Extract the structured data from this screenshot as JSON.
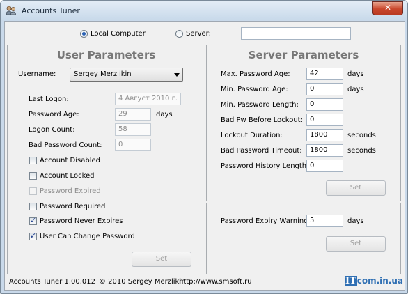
{
  "window": {
    "title": "Accounts Tuner",
    "close_glyph": "✕"
  },
  "target": {
    "local_label": "Local Computer",
    "server_label": "Server:",
    "server_value": "",
    "selected": "local"
  },
  "user_panel": {
    "title": "User Parameters",
    "username_label": "Username:",
    "username_value": "Sergey Merzlikin",
    "fields": [
      {
        "label": "Last Logon:",
        "value": "4 Август 2010 г.",
        "unit": ""
      },
      {
        "label": "Password Age:",
        "value": "29",
        "unit": "days"
      },
      {
        "label": "Logon Count:",
        "value": "58",
        "unit": ""
      },
      {
        "label": "Bad Password Count:",
        "value": "0",
        "unit": ""
      }
    ],
    "checkboxes": [
      {
        "label": "Account Disabled",
        "checked": false,
        "enabled": true
      },
      {
        "label": "Account Locked",
        "checked": false,
        "enabled": true
      },
      {
        "label": "Password Expired",
        "checked": false,
        "enabled": false
      },
      {
        "label": "Password Required",
        "checked": false,
        "enabled": true
      },
      {
        "label": "Password Never Expires",
        "checked": true,
        "enabled": true
      },
      {
        "label": "User Can Change Password",
        "checked": true,
        "enabled": true
      }
    ],
    "set_label": "Set"
  },
  "server_panel": {
    "title": "Server Parameters",
    "fields": [
      {
        "label": "Max. Password Age:",
        "value": "42",
        "unit": "days"
      },
      {
        "label": "Min. Password Age:",
        "value": "0",
        "unit": "days"
      },
      {
        "label": "Min. Password Length:",
        "value": "0",
        "unit": ""
      },
      {
        "label": "Bad Pw Before Lockout:",
        "value": "0",
        "unit": ""
      },
      {
        "label": "Lockout Duration:",
        "value": "1800",
        "unit": "seconds"
      },
      {
        "label": "Bad Password Timeout:",
        "value": "1800",
        "unit": "seconds"
      },
      {
        "label": "Password History Length:",
        "value": "0",
        "unit": ""
      }
    ],
    "set_label": "Set"
  },
  "expiry_panel": {
    "label": "Password Expiry Warning:",
    "value": "5",
    "unit": "days",
    "set_label": "Set"
  },
  "statusbar": {
    "version": "Accounts Tuner 1.00.012",
    "copyright": "© 2010 Sergey Merzlikin",
    "url": "http://www.smsoft.ru",
    "logo_it": "IT",
    "logo_rest": "com.in.ua"
  },
  "icons": {
    "app": "users-icon",
    "check": "checkmark-icon",
    "dropdown": "chevron-down-icon"
  }
}
